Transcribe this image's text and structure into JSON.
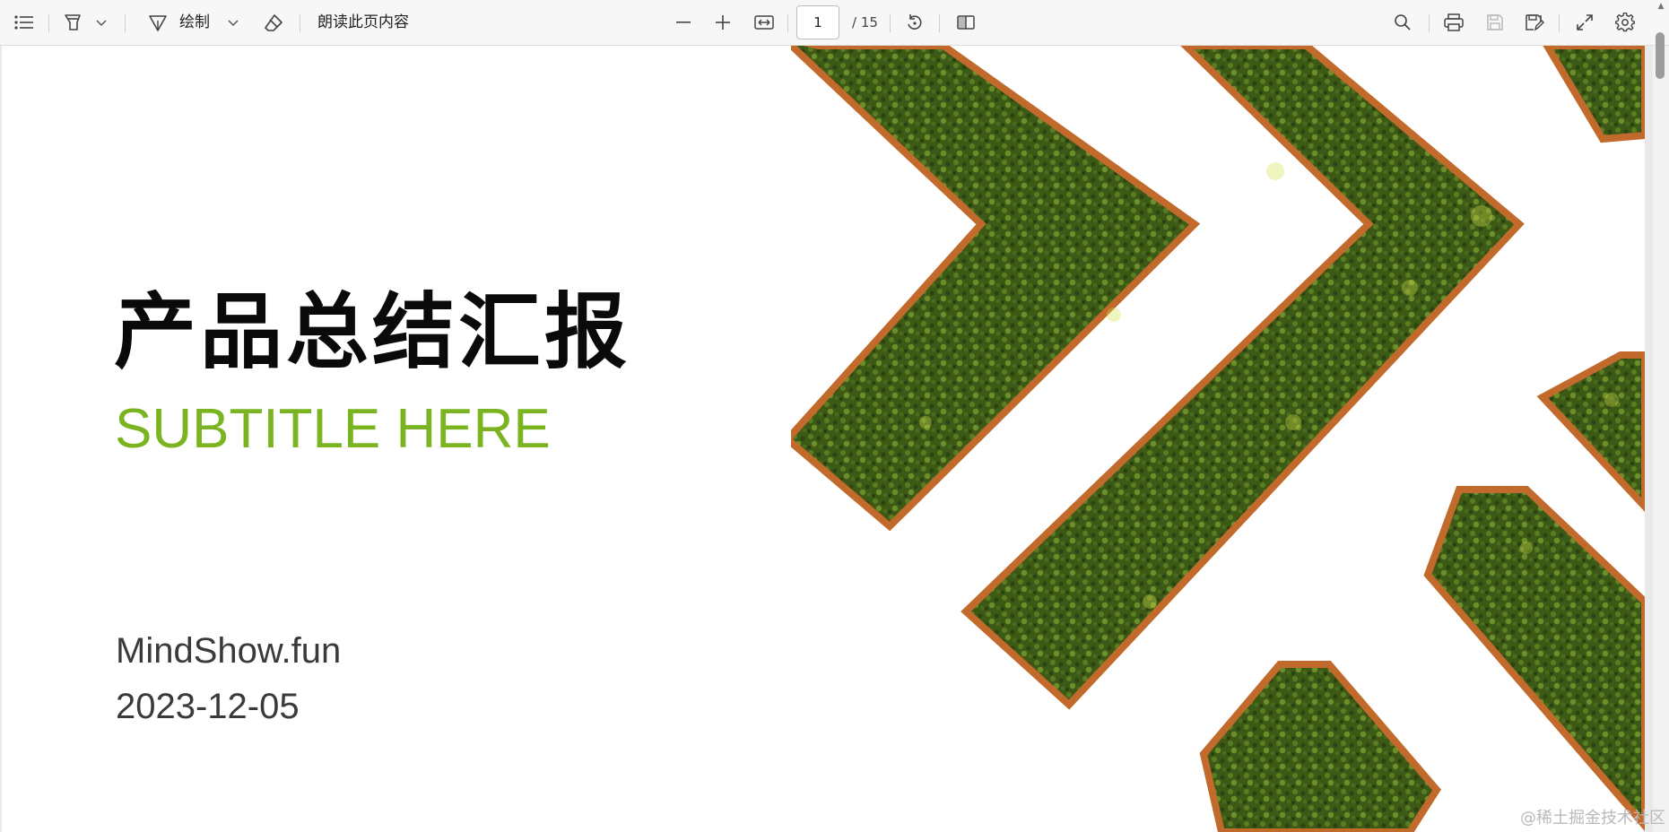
{
  "toolbar": {
    "draw_label": "绘制",
    "read_aloud_label": "朗读此页内容",
    "page_current": "1",
    "page_total": "/ 15"
  },
  "icons": {
    "contents": "contents-list-icon",
    "highlight": "highlighter-icon",
    "draw": "draw-pen-icon",
    "erase": "eraser-icon",
    "zoom_out": "minus-icon",
    "zoom_in": "plus-icon",
    "fit": "fit-width-icon",
    "rotate": "rotate-icon",
    "page_view": "page-view-icon",
    "search": "search-icon",
    "print": "print-icon",
    "save": "save-icon",
    "save_as": "save-as-icon",
    "fullscreen": "fullscreen-icon",
    "settings": "gear-icon"
  },
  "slide": {
    "title": "产品总结汇报",
    "subtitle": "SUBTITLE HERE",
    "brand": "MindShow.fun",
    "date": "2023-12-05"
  },
  "colors": {
    "subtitle": "#7bb421",
    "hedge": "#3f5a18",
    "planter": "#c26a2c"
  },
  "watermark": "@稀土掘金技术社区"
}
